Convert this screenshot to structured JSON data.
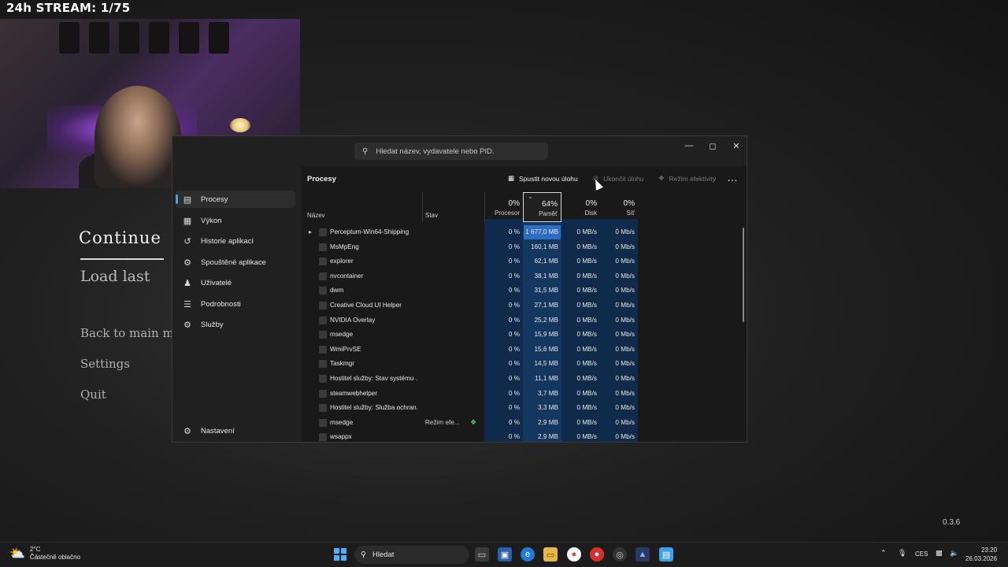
{
  "stream": {
    "title": "24h STREAM: 1/75"
  },
  "game_menu": {
    "continue": "Continue",
    "load_last": "Load last",
    "back_to_main": "Back to main m",
    "settings": "Settings",
    "quit": "Quit",
    "version": "0.3.6"
  },
  "task_manager": {
    "search_placeholder": "Hledat název, vydavatele nebo PID.",
    "nav": [
      {
        "label": "Procesy",
        "icon": "processes-icon"
      },
      {
        "label": "Výkon",
        "icon": "performance-icon"
      },
      {
        "label": "Historie aplikací",
        "icon": "app-history-icon"
      },
      {
        "label": "Spouštěné aplikace",
        "icon": "startup-apps-icon"
      },
      {
        "label": "Uživatelé",
        "icon": "users-icon"
      },
      {
        "label": "Podrobnosti",
        "icon": "details-icon"
      },
      {
        "label": "Služby",
        "icon": "services-icon"
      }
    ],
    "settings_label": "Nastavení",
    "page_title": "Procesy",
    "toolbar": {
      "run_new_task": "Spustit novou úlohu",
      "end_task": "Ukončit úlohu",
      "efficiency_mode": "Režim efektivity"
    },
    "columns": {
      "name": "Název",
      "status": "Stav",
      "cpu_pct": "0%",
      "cpu_label": "Procesor",
      "mem_pct": "64%",
      "mem_label": "Paměť",
      "disk_pct": "0%",
      "disk_label": "Disk",
      "net_pct": "0%",
      "net_label": "Síť"
    },
    "processes": [
      {
        "name": "Perceptum-Win64-Shipping",
        "status": "",
        "cpu": "0 %",
        "mem": "1 677,0 MB",
        "disk": "0 MB/s",
        "net": "0 Mb/s",
        "expandable": true
      },
      {
        "name": "MsMpEng",
        "status": "",
        "cpu": "0 %",
        "mem": "160,1 MB",
        "disk": "0 MB/s",
        "net": "0 Mb/s"
      },
      {
        "name": "explorer",
        "status": "",
        "cpu": "0 %",
        "mem": "62,1 MB",
        "disk": "0 MB/s",
        "net": "0 Mb/s"
      },
      {
        "name": "nvcontainer",
        "status": "",
        "cpu": "0 %",
        "mem": "38,1 MB",
        "disk": "0 MB/s",
        "net": "0 Mb/s"
      },
      {
        "name": "dwm",
        "status": "",
        "cpu": "0 %",
        "mem": "31,5 MB",
        "disk": "0 MB/s",
        "net": "0 Mb/s"
      },
      {
        "name": "Creative Cloud UI Helper",
        "status": "",
        "cpu": "0 %",
        "mem": "27,1 MB",
        "disk": "0 MB/s",
        "net": "0 Mb/s"
      },
      {
        "name": "NVIDIA Overlay",
        "status": "",
        "cpu": "0 %",
        "mem": "25,2 MB",
        "disk": "0 MB/s",
        "net": "0 Mb/s"
      },
      {
        "name": "msedge",
        "status": "",
        "cpu": "0 %",
        "mem": "15,9 MB",
        "disk": "0 MB/s",
        "net": "0 Mb/s"
      },
      {
        "name": "WmiPrvSE",
        "status": "",
        "cpu": "0 %",
        "mem": "15,6 MB",
        "disk": "0 MB/s",
        "net": "0 Mb/s"
      },
      {
        "name": "Taskmgr",
        "status": "",
        "cpu": "0 %",
        "mem": "14,5 MB",
        "disk": "0 MB/s",
        "net": "0 Mb/s"
      },
      {
        "name": "Hostitel služby: Stav systému ...",
        "status": "",
        "cpu": "0 %",
        "mem": "11,1 MB",
        "disk": "0 MB/s",
        "net": "0 Mb/s"
      },
      {
        "name": "steamwebhelper",
        "status": "",
        "cpu": "0 %",
        "mem": "3,7 MB",
        "disk": "0 MB/s",
        "net": "0 Mb/s"
      },
      {
        "name": "Hostitel služby: Služba ochran...",
        "status": "",
        "cpu": "0 %",
        "mem": "3,3 MB",
        "disk": "0 MB/s",
        "net": "0 Mb/s"
      },
      {
        "name": "msedge",
        "status": "Režim efe...",
        "cpu": "0 %",
        "mem": "2,9 MB",
        "disk": "0 MB/s",
        "net": "0 Mb/s",
        "efficiency_leaf": true
      },
      {
        "name": "wsappx",
        "status": "",
        "cpu": "0 %",
        "mem": "2,9 MB",
        "disk": "0 MB/s",
        "net": "0 Mb/s"
      }
    ]
  },
  "taskbar": {
    "weather_temp": "2°C",
    "weather_desc": "Částečně oblačno",
    "search_label": "Hledat",
    "language": "CES",
    "time": "23:20",
    "date": "26.03.2026"
  },
  "colors": {
    "accent": "#4ca0e0",
    "heat_low": "#0f2a4a",
    "heat_mid": "#143760",
    "heat_high": "#2d6ec2"
  }
}
